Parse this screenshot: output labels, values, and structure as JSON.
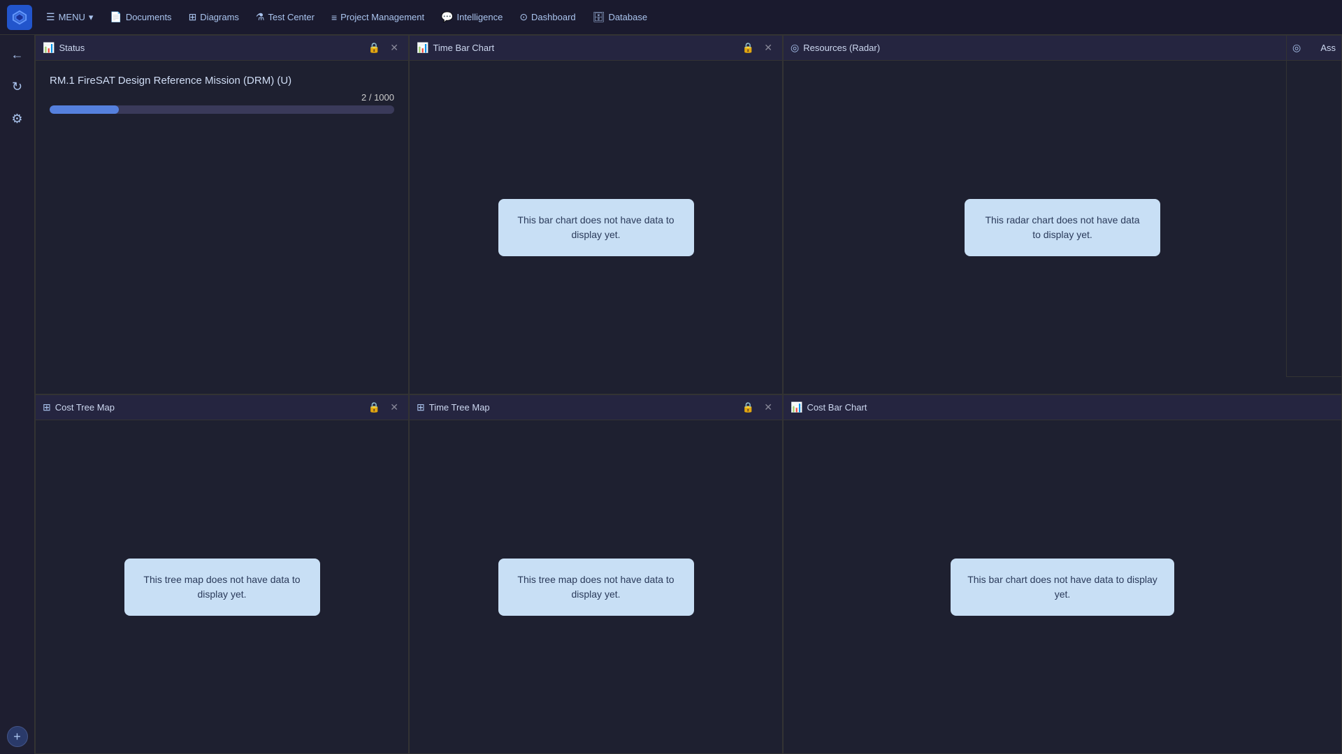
{
  "topnav": {
    "menu_label": "MENU",
    "items": [
      {
        "id": "documents",
        "label": "Documents",
        "icon": "📄"
      },
      {
        "id": "diagrams",
        "label": "Diagrams",
        "icon": "⊞"
      },
      {
        "id": "test-center",
        "label": "Test Center",
        "icon": "⚗"
      },
      {
        "id": "project-management",
        "label": "Project Management",
        "icon": "≡"
      },
      {
        "id": "intelligence",
        "label": "Intelligence",
        "icon": "💬"
      },
      {
        "id": "dashboard",
        "label": "Dashboard",
        "icon": "⊙"
      },
      {
        "id": "database",
        "label": "Database",
        "icon": "🗄"
      }
    ]
  },
  "sidebar": {
    "back_label": "←",
    "refresh_label": "↻",
    "settings_label": "⚙"
  },
  "panels": {
    "status": {
      "title": "Status",
      "icon": "📊",
      "mission_title": "RM.1 FireSAT Design Reference Mission (DRM) (U)",
      "progress_text": "2 / 1000",
      "progress_value": 0.2
    },
    "time_bar_chart": {
      "title": "Time Bar Chart",
      "icon": "📊",
      "empty_message": "This bar chart does not have data to display yet."
    },
    "resources_radar": {
      "title": "Resources (Radar)",
      "icon": "◎",
      "empty_message": "This radar chart does not have data to display yet."
    },
    "ass": {
      "title": "Ass",
      "icon": "◎"
    },
    "cost_tree_map": {
      "title": "Cost Tree Map",
      "icon": "⊞",
      "empty_message": "This tree map does not have data to display yet."
    },
    "time_tree_map": {
      "title": "Time Tree Map",
      "icon": "⊞",
      "empty_message": "This tree map does not have data to display yet."
    },
    "cost_bar_chart": {
      "title": "Cost Bar Chart",
      "icon": "📊",
      "empty_message": "This bar chart does not have data to display yet."
    }
  },
  "controls": {
    "lock_icon": "🔒",
    "close_icon": "✕",
    "add_icon": "+"
  }
}
